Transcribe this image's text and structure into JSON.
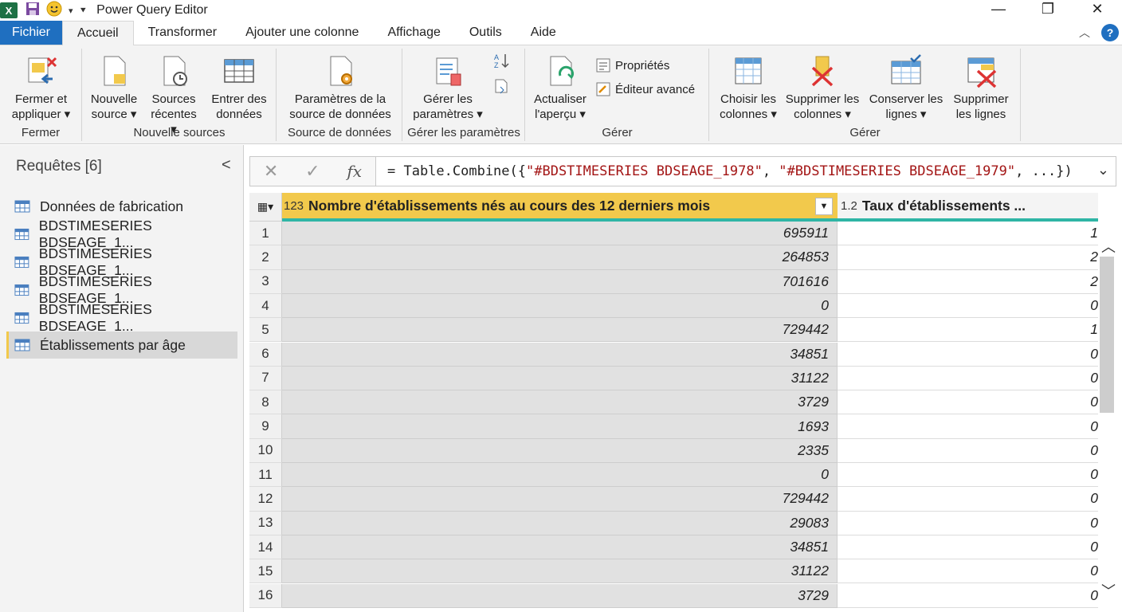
{
  "window": {
    "title": "Power Query Editor",
    "app_icon": "X",
    "minimize": "—",
    "restore": "❐",
    "close": "✕"
  },
  "tabs": [
    {
      "label": "Fichier"
    },
    {
      "label": "Accueil"
    },
    {
      "label": "Transformer"
    },
    {
      "label": "Ajouter une colonne"
    },
    {
      "label": "Affichage"
    },
    {
      "label": "Outils"
    },
    {
      "label": "Aide"
    }
  ],
  "help_label": "?",
  "ribbon": {
    "groups": {
      "fermer": "Fermer",
      "nouvelle": "Nouvelle sources",
      "source": "Source de données",
      "params": "Gérer les paramètres",
      "gerer1": "Gérer",
      "gerer2": "Gérer"
    },
    "buttons": {
      "fermer_l1": "Fermer et",
      "fermer_l2": "appliquer ▾",
      "nouvelle_l1": "Nouvelle",
      "nouvelle_l2": "source ▾",
      "recentes_l1": "Sources",
      "recentes_l2": "récentes ▾",
      "entrer_l1": "Entrer des",
      "entrer_l2": "données",
      "params_src_l1": "Paramètres de la",
      "params_src_l2": "source de données",
      "gerer_params_l1": "Gérer les",
      "gerer_params_l2": "paramètres ▾",
      "actualiser_l1": "Actualiser",
      "actualiser_l2": "l'aperçu ▾",
      "proprietes": "Propriétés",
      "editeur": "Éditeur avancé",
      "choisir_l1": "Choisir les",
      "choisir_l2": "colonnes ▾",
      "supprimer_col_l1": "Supprimer les",
      "supprimer_col_l2": "colonnes ▾",
      "conserver_l1": "Conserver les",
      "conserver_l2": "lignes ▾",
      "supprimer_lig_l1": "Supprimer",
      "supprimer_lig_l2": "les lignes"
    }
  },
  "queries": {
    "title": "Requêtes [6]",
    "collapse": "<",
    "items": [
      {
        "label": "Données de fabrication"
      },
      {
        "label": "BDSTIMESERIES BDSEAGE_1..."
      },
      {
        "label": "BDSTIMESERIES BDSEAGE_1..."
      },
      {
        "label": "BDSTIMESERIES BDSEAGE_1..."
      },
      {
        "label": "BDSTIMESERIES BDSEAGE_1..."
      },
      {
        "label": "Établissements par âge"
      }
    ]
  },
  "formula": {
    "cancel": "✕",
    "commit": "✓",
    "fx": "fx",
    "prefix": "= Table.Combine({",
    "arg1": "\"#BDSTIMESERIES BDSEAGE_1978\"",
    "sep": ", ",
    "arg2": "\"#BDSTIMESERIES BDSEAGE_1979\"",
    "suffix": ", ...})",
    "expand": "⌄"
  },
  "table": {
    "columns": [
      {
        "type": "123",
        "name": "Nombre d'établissements nés au cours des 12 derniers mois"
      },
      {
        "type": "1.2",
        "name": "Taux d'établissements ..."
      }
    ],
    "rows": [
      {
        "i": "1",
        "c1": "695911",
        "c2": "1"
      },
      {
        "i": "2",
        "c1": "264853",
        "c2": "2"
      },
      {
        "i": "3",
        "c1": "701616",
        "c2": "2"
      },
      {
        "i": "4",
        "c1": "0",
        "c2": "0"
      },
      {
        "i": "5",
        "c1": "729442",
        "c2": "1"
      },
      {
        "i": "6",
        "c1": "34851",
        "c2": "0"
      },
      {
        "i": "7",
        "c1": "31122",
        "c2": "0"
      },
      {
        "i": "8",
        "c1": "3729",
        "c2": "0"
      },
      {
        "i": "9",
        "c1": "1693",
        "c2": "0"
      },
      {
        "i": "10",
        "c1": "2335",
        "c2": "0"
      },
      {
        "i": "11",
        "c1": "0",
        "c2": "0"
      },
      {
        "i": "12",
        "c1": "729442",
        "c2": "0"
      },
      {
        "i": "13",
        "c1": "29083",
        "c2": "0"
      },
      {
        "i": "14",
        "c1": "34851",
        "c2": "0"
      },
      {
        "i": "15",
        "c1": "31122",
        "c2": "0"
      },
      {
        "i": "16",
        "c1": "3729",
        "c2": "0"
      }
    ]
  },
  "colors": {
    "file_tab": "#1f6fc0",
    "selected_column": "#f2c94c",
    "quality_bar": "#2fb5a5",
    "excel_green": "#1e7145"
  }
}
